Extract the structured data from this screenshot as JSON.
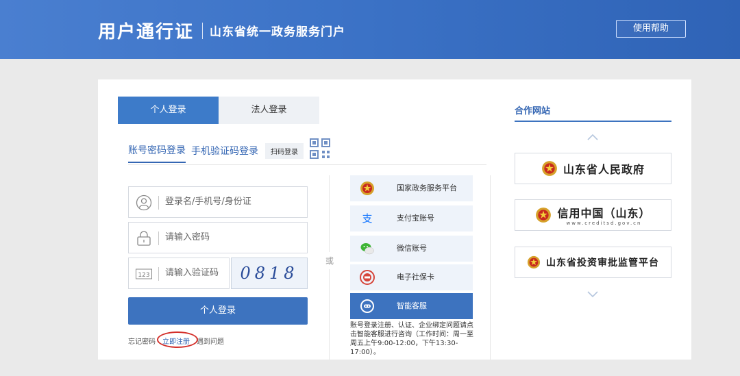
{
  "header": {
    "title": "用户通行证",
    "subtitle": "山东省统一政务服务门户",
    "help_label": "使用帮助"
  },
  "login_tabs": {
    "personal": "个人登录",
    "corporate": "法人登录"
  },
  "sub_tabs": {
    "password": "账号密码登录",
    "sms": "手机验证码登录",
    "scan": "扫码登录"
  },
  "form": {
    "username_placeholder": "登录名/手机号/身份证",
    "password_placeholder": "请输入密码",
    "code_placeholder": "请输入验证码",
    "code_icon_text": "123",
    "captcha_text": "0818",
    "submit_label": "个人登录"
  },
  "links": {
    "forgot": "忘记密码",
    "register": "立即注册",
    "problem": "遇到问题"
  },
  "divider": "或",
  "providers": [
    {
      "label": "国家政务服务平台",
      "icon": "national-emblem-icon"
    },
    {
      "label": "支付宝账号",
      "icon": "alipay-icon"
    },
    {
      "label": "微信账号",
      "icon": "wechat-icon"
    },
    {
      "label": "电子社保卡",
      "icon": "social-security-card-icon"
    },
    {
      "label": "智能客服",
      "icon": "smart-service-icon"
    }
  ],
  "note": "账号登录注册、认证、企业绑定问题请点击智能客服进行咨询（工作时间：周一至周五上午9:00-12:00，下午13:30-17:00）。",
  "partners": {
    "title": "合作网站",
    "items": [
      {
        "name": "山东省人民政府",
        "domain": ""
      },
      {
        "name": "信用中国（山东）",
        "domain": "www.creditsd.gov.cn"
      },
      {
        "name": "山东省投资审批监管平台",
        "domain": ""
      }
    ]
  },
  "colors": {
    "header_blue": "#3c73c7",
    "primary_blue": "#3d73bf",
    "link_blue": "#3466b3",
    "highlight_red": "#d4302b"
  }
}
